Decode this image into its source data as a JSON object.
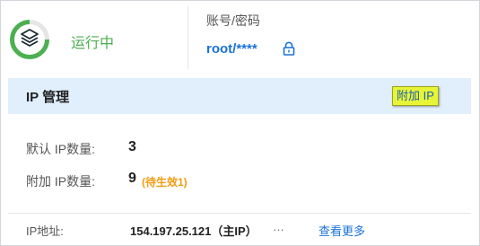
{
  "status": {
    "icon": "server-running-icon",
    "text": "运行中",
    "color": "#4caf50"
  },
  "account": {
    "label": "账号/密码",
    "value": "root/****",
    "lock_icon": "lock-icon"
  },
  "ip_management": {
    "title": "IP 管理",
    "attach_button_label": "附加 IP",
    "default_ip_count_label": "默认 IP数量:",
    "default_ip_count": "3",
    "attached_ip_count_label": "附加 IP数量:",
    "attached_ip_count": "9",
    "pending_note": "(待生效1)",
    "ip_address_label": "IP地址:",
    "ip_address_value": "154.197.25.121（主IP）",
    "ellipsis": "…",
    "view_more_label": "查看更多"
  },
  "colors": {
    "accent_blue": "#1a73d9",
    "header_band": "#e1eefc",
    "pending_orange": "#f39c12",
    "highlight": "#e8f536"
  }
}
